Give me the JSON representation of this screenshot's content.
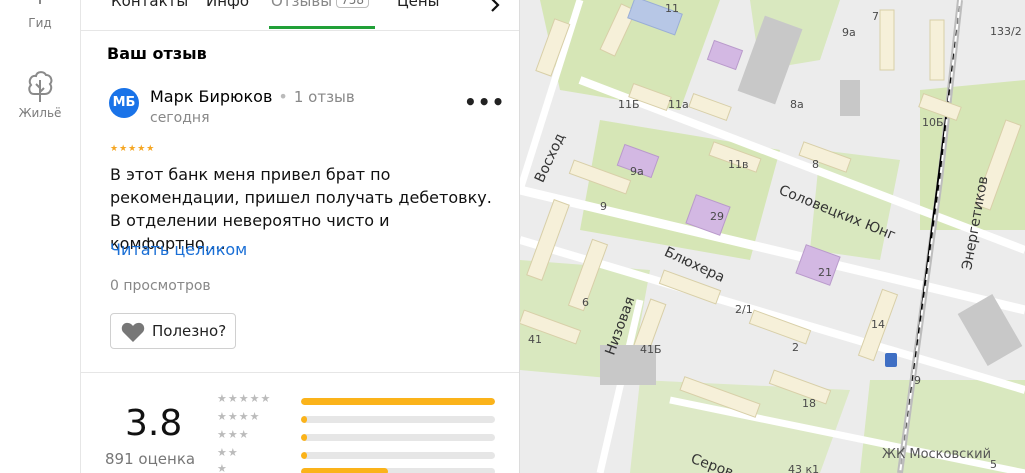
{
  "rail": {
    "items": [
      {
        "label": "Гид"
      },
      {
        "label": "Жильё"
      }
    ]
  },
  "tabs": [
    {
      "label": "Контакты"
    },
    {
      "label": "Инфо"
    },
    {
      "label": "Отзывы",
      "count": "758"
    },
    {
      "label": "Цены"
    }
  ],
  "review": {
    "section_title": "Ваш отзыв",
    "avatar_initials": "МБ",
    "author": "Марк Бирюков",
    "author_reviews": "1 отзыв",
    "date": "сегодня",
    "stars": 5,
    "text": "В этот банк меня привел брат по рекомендации, пришел получать дебетовку. В отделении невероятно чисто и комфортно,…",
    "read_more": "Читать целиком",
    "views": "0 просмотров",
    "helpful_label": "Полезно?"
  },
  "rating": {
    "value": "3.8",
    "count_label": "891 оценка",
    "distribution": [
      {
        "stars": 5,
        "fraction": 1.0
      },
      {
        "stars": 4,
        "fraction": 0.03
      },
      {
        "stars": 3,
        "fraction": 0.03
      },
      {
        "stars": 2,
        "fraction": 0.03
      },
      {
        "stars": 1,
        "fraction": 0.45
      }
    ]
  },
  "map": {
    "streets": [
      "Восход",
      "Блюхера",
      "Соловецких Юнг",
      "Энергетиков",
      "Низовая",
      "Серов"
    ],
    "numbers": [
      "11",
      "7",
      "9а",
      "133/2",
      "8а",
      "11Б",
      "11а",
      "10Б",
      "11в",
      "8",
      "9а",
      "9",
      "29",
      "21",
      "6",
      "2/1",
      "41",
      "41Б",
      "2",
      "14",
      "18",
      "9",
      "43 к1",
      "5"
    ],
    "poi": "ЖК Московский",
    "colors": {
      "map_bg": "#ececec",
      "green": "#cfe3a8",
      "building": "#f6f0d9",
      "poi": "#d3b8e3"
    }
  }
}
